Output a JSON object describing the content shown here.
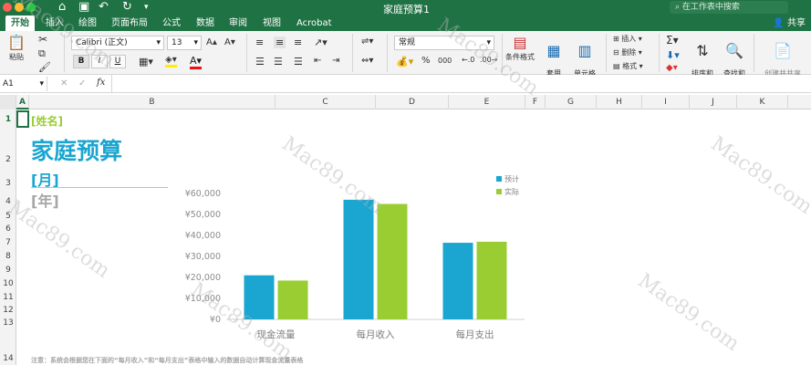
{
  "window": {
    "title": "家庭预算1"
  },
  "search": {
    "placeholder": "在工作表中搜索"
  },
  "share_label": "共享",
  "tabs": [
    "开始",
    "插入",
    "绘图",
    "页面布局",
    "公式",
    "数据",
    "审阅",
    "视图",
    "Acrobat"
  ],
  "ribbon": {
    "paste_label": "粘贴",
    "font_name": "Calibri (正文)",
    "font_size": "13",
    "bold": "B",
    "italic": "I",
    "underline": "U",
    "number_format": "常规",
    "percent": "%",
    "thousands": "000",
    "cond_format": "条件格式",
    "table_format": "套用\n表格格式",
    "cell_style": "单元格\n样式",
    "insert": "插入",
    "delete": "删除",
    "format": "格式",
    "sort_filter": "排序和\n筛选",
    "find_select": "查找和\n选择",
    "create_share_pdf": "创建并共享\nAdobe PDF"
  },
  "formula_bar": {
    "name_box": "A1",
    "fx": "fx",
    "content": ""
  },
  "columns": [
    "A",
    "B",
    "C",
    "D",
    "E",
    "F",
    "G",
    "H",
    "I",
    "J",
    "K"
  ],
  "rows": [
    "1",
    "2",
    "3",
    "4",
    "5",
    "6",
    "7",
    "8",
    "9",
    "10",
    "11",
    "12",
    "13",
    "14"
  ],
  "sheet": {
    "name_placeholder": "[姓名]",
    "title": "家庭预算",
    "month": "[月]",
    "year": "[年]",
    "note": "注意：系统会根据您在下面的“每月收入”和“每月支出”表格中输入的数据自动计算现金流量表格"
  },
  "chart_data": {
    "type": "bar",
    "categories": [
      "现金流量",
      "每月收入",
      "每月支出"
    ],
    "series": [
      {
        "name": "预计",
        "values": [
          21000,
          57000,
          36500
        ],
        "color": "#1aa6d0"
      },
      {
        "name": "实际",
        "values": [
          18500,
          55000,
          37000
        ],
        "color": "#9acd32"
      }
    ],
    "ylim": [
      0,
      60000
    ],
    "yticks": [
      "¥0",
      "¥10,000",
      "¥20,000",
      "¥30,000",
      "¥40,000",
      "¥50,000",
      "¥60,000"
    ],
    "legend": "top-right"
  },
  "colors": {
    "accent_green": "#1f7244",
    "title_blue": "#1aa6d0",
    "name_green": "#9acd32",
    "gray": "#a6a6a6"
  },
  "watermark": "Mac89.com"
}
